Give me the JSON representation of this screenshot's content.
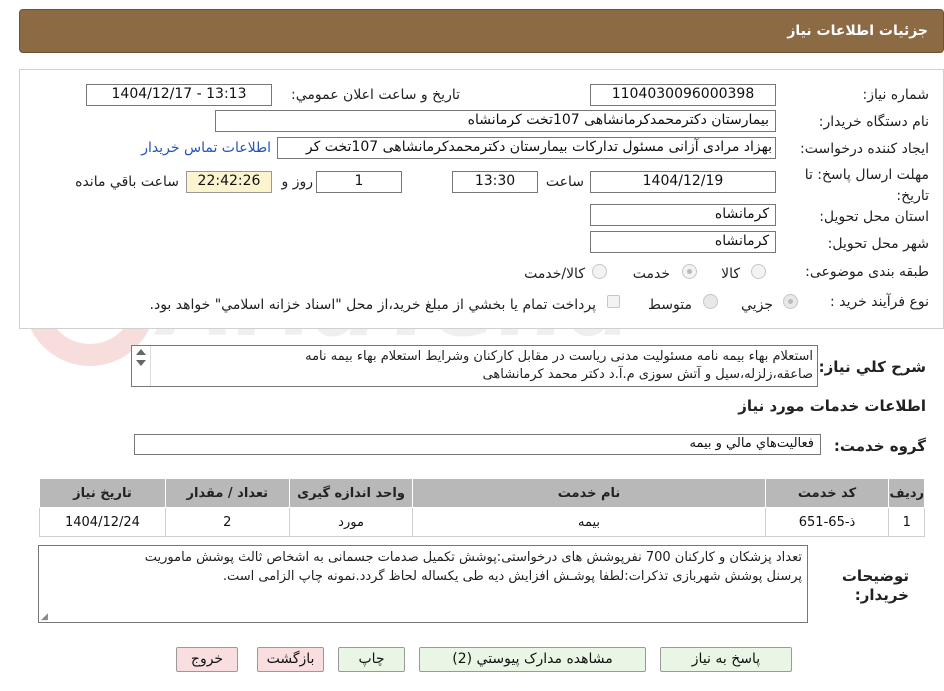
{
  "header": {
    "title": "جزئیات اطلاعات نیاز"
  },
  "form": {
    "need_number_label": "شماره نیاز:",
    "need_number": "1104030096000398",
    "announce_label": "تاریخ و ساعت اعلان عمومي:",
    "announce_value": "1404/12/17 - 13:13",
    "buyer_org_label": "نام دستگاه خريدار:",
    "buyer_org": "بیمارستان دکترمحمدکرمانشاهی 107تخت کرمانشاه",
    "creator_label": "ایجاد کننده درخواست:",
    "creator": "بهزاد مرادی آزانی مسئول تدارکات بیمارستان دکترمحمدکرمانشاهی 107تخت کر",
    "contact_link": "اطلاعات تماس خريدار",
    "deadline_label": "مهلت ارسال پاسخ: تا تاریخ:",
    "deadline_date": "1404/12/19",
    "time_word": "ساعت",
    "deadline_time": "13:30",
    "days_value": "1",
    "days_word": "روز و",
    "remaining_time": "22:42:26",
    "remaining_word": "ساعت باقي مانده",
    "province_label": "استان محل تحویل:",
    "province": "کرمانشاه",
    "city_label": "شهر محل تحویل:",
    "city": "کرمانشاه",
    "category_label": "طبقه بندی موضوعی:",
    "category_options": [
      "کالا",
      "خدمت",
      "کالا/خدمت"
    ],
    "process_label": "نوع فرآیند خرید :",
    "process_options": [
      "جزيي",
      "متوسط"
    ],
    "payment_note": "پرداخت تمام يا بخشي از مبلغ خريد،از محل \"اسناد خزانه اسلامي\" خواهد بود."
  },
  "description": {
    "label": "شرح کلي نياز:",
    "text_line1": "استعلام بهاء بیمه نامه مسئولیت مدنی ریاست در مقابل کارکنان وشرایط استعلام بهاء بیمه نامه",
    "text_line2": "صاعقه،زلزله،سیل و آتش سوزی م.آ.د دکتر محمد کرمانشاهی"
  },
  "services": {
    "title": "اطلاعات خدمات مورد نياز",
    "group_label": "گروه خدمت:",
    "group_value": "فعاليت‌هاي مالي و بيمه",
    "columns": [
      "رديف",
      "کد خدمت",
      "نام خدمت",
      "واحد اندازه گيری",
      "تعداد / مقدار",
      "تاريخ نياز"
    ],
    "rows": [
      {
        "index": "1",
        "code": "ذ-65-651",
        "name": "بیمه",
        "unit": "مورد",
        "qty": "2",
        "date": "1404/12/24"
      }
    ]
  },
  "buyer_notes": {
    "label_line1": "توضيحات",
    "label_line2": "خريدار:",
    "text_line1": "تعداد پزشکان و کارکنان 700 نفرپوشش های درخواستی:پوشش تکمیل صدمات جسمانی به اشخاص ثالث پوشش ماموریت",
    "text_line2": "پرسنل پوشش شهربازی تذکرات:لطفا پوشـش افزایش دیه طی یکساله لحاظ گردد.نمونه چاپ الزامی است."
  },
  "buttons": {
    "reply": "پاسخ به نياز",
    "attachments": "مشاهده مدارک پيوستي (2)",
    "print": "چاپ",
    "back": "بازگشت",
    "exit": "خروج"
  }
}
